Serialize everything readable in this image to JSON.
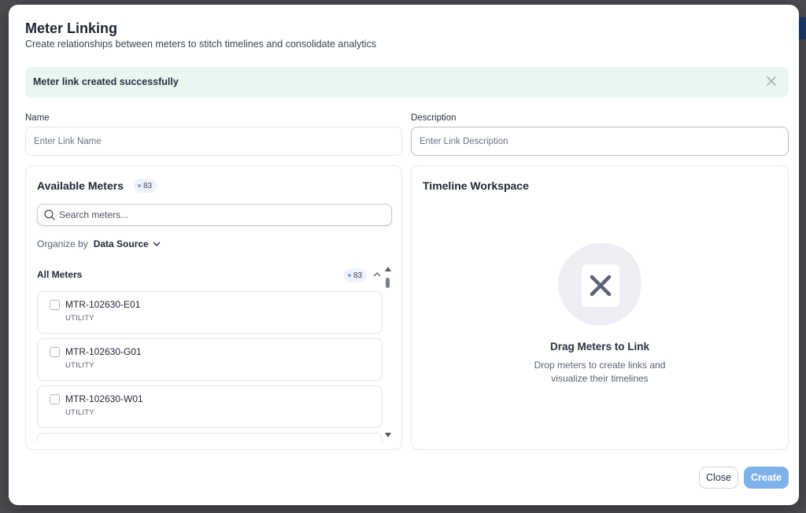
{
  "dialog": {
    "title": "Meter Linking",
    "subtitle": "Create relationships between meters to stitch timelines and consolidate analytics"
  },
  "alert": {
    "message": "Meter link created successfully",
    "close_icon": "close-icon"
  },
  "form": {
    "name": {
      "label": "Name",
      "placeholder": "Enter Link Name",
      "value": ""
    },
    "description": {
      "label": "Description",
      "placeholder": "Enter Link Description",
      "value": ""
    }
  },
  "available_meters": {
    "title": "Available Meters",
    "count": "83",
    "search": {
      "placeholder": "Search meters...",
      "icon": "search-icon"
    },
    "organize": {
      "label": "Organize by",
      "selected": "Data Source"
    },
    "group": {
      "title": "All Meters",
      "count": "83",
      "items": [
        {
          "id": "MTR-102630-E01",
          "type": "UTILITY"
        },
        {
          "id": "MTR-102630-G01",
          "type": "UTILITY"
        },
        {
          "id": "MTR-102630-W01",
          "type": "UTILITY"
        }
      ]
    }
  },
  "timeline_workspace": {
    "title": "Timeline Workspace",
    "empty_title": "Drag Meters to Link",
    "empty_desc_line1": "Drop meters to create links and",
    "empty_desc_line2": "visualize their timelines",
    "empty_icon": "x-icon"
  },
  "footer": {
    "close_label": "Close",
    "create_label": "Create"
  },
  "colors": {
    "alert_bg": "#eaf7f1",
    "primary_button": "#7fb2ea",
    "badge_dot": "#7fa7d9",
    "empty_icon_color": "#5b6178"
  }
}
